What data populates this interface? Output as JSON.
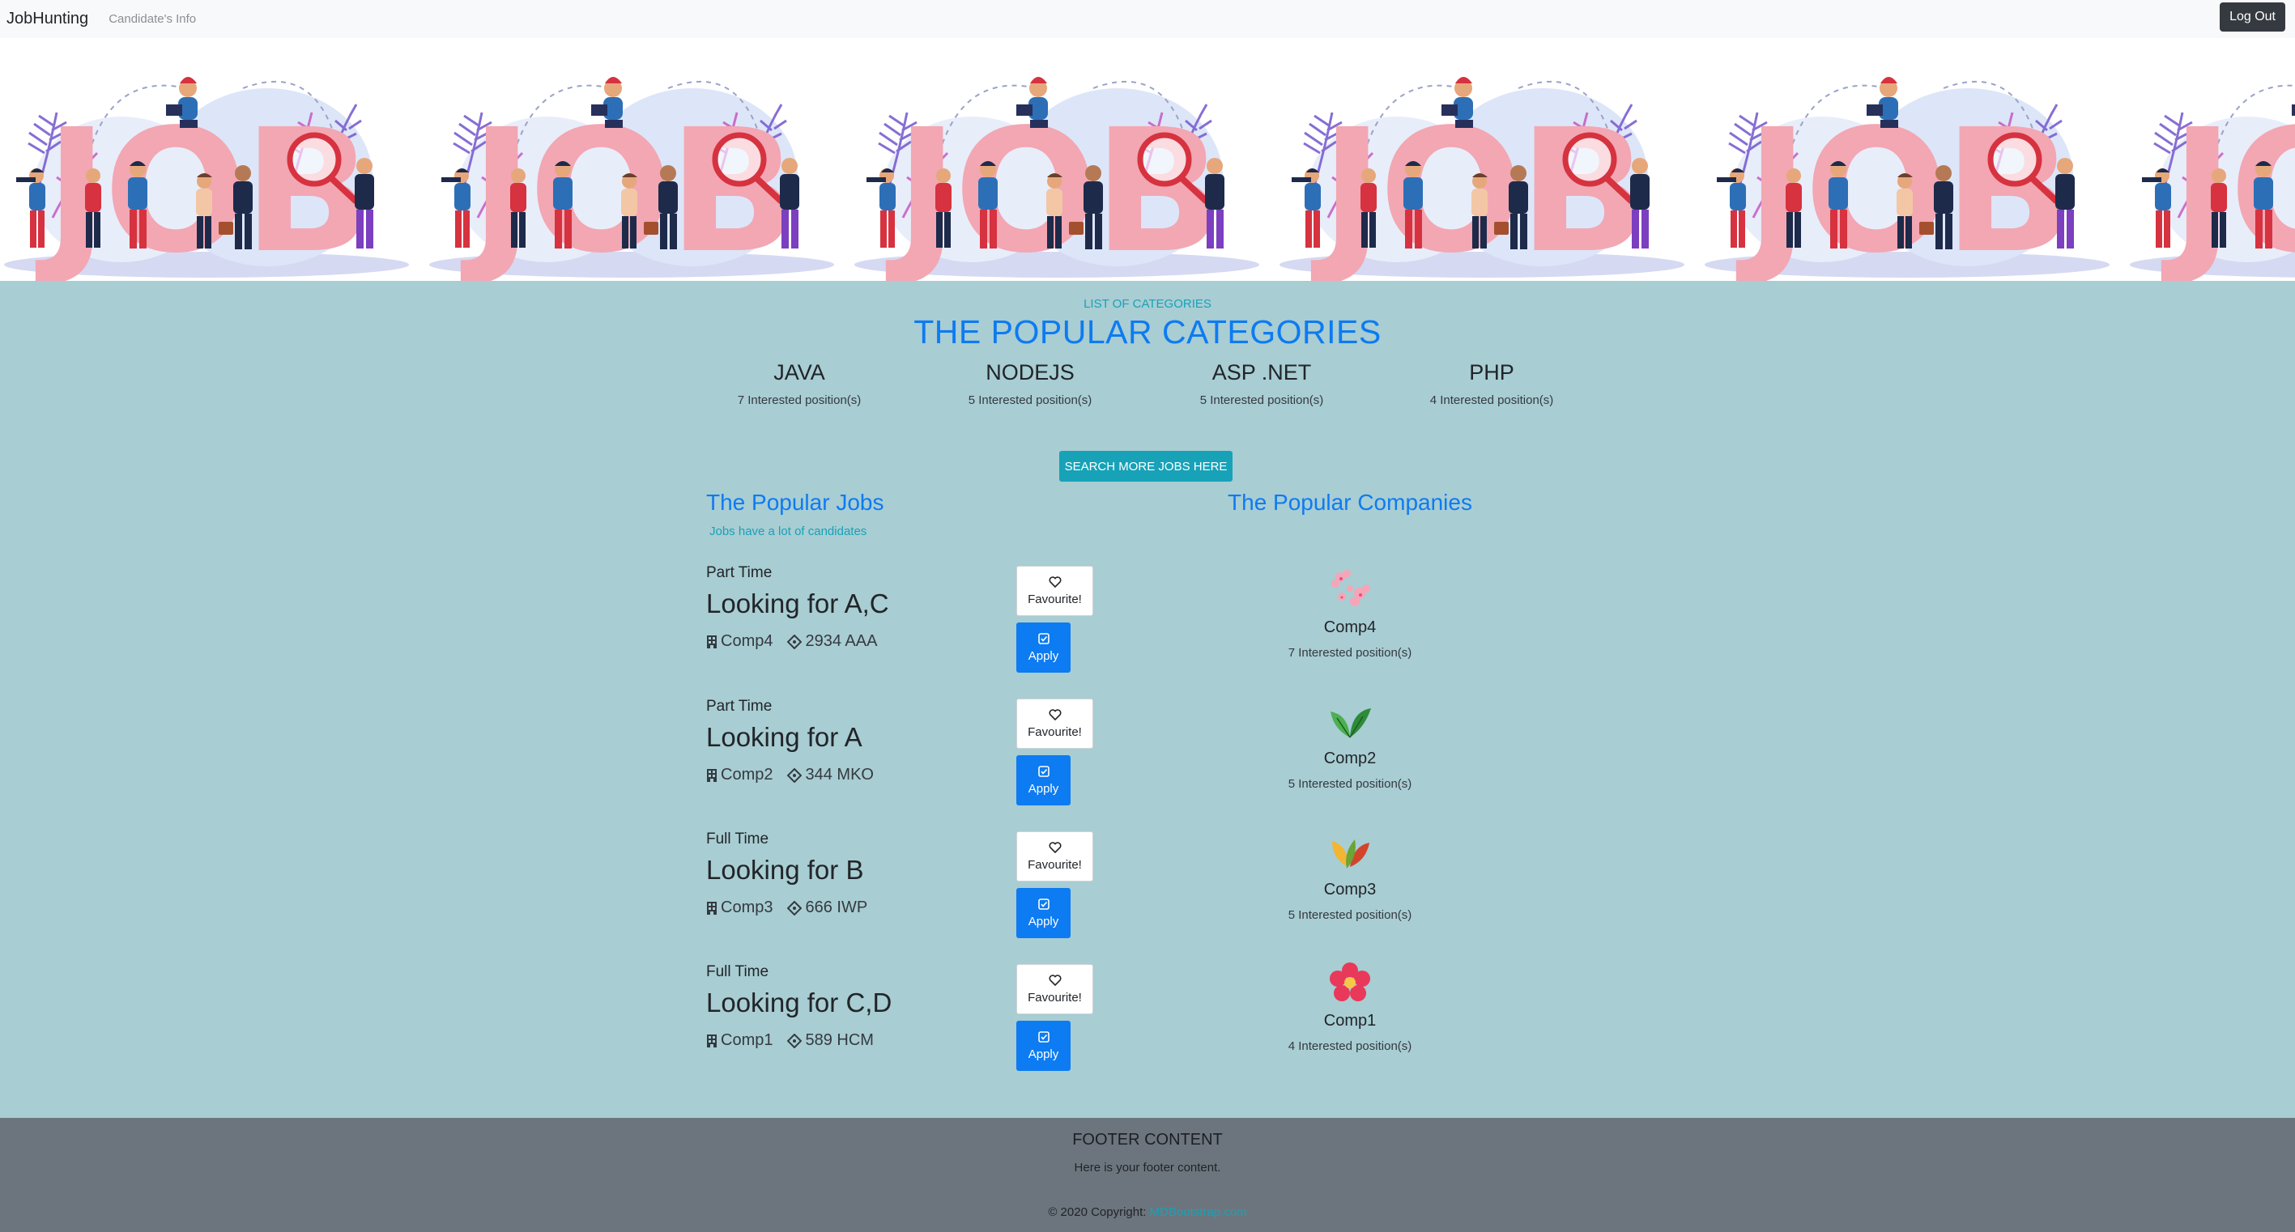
{
  "navbar": {
    "brand": "JobHunting",
    "link": "Candidate's Info",
    "logout": "Log Out"
  },
  "hero": {
    "illustration": "JOB",
    "icon": "job-hunting-illustration"
  },
  "categories": {
    "eyebrow": "LIST OF CATEGORIES",
    "title": "THE POPULAR CATEGORIES",
    "items": [
      {
        "name": "JAVA",
        "count": "7 Interested position(s)"
      },
      {
        "name": "NODEJS",
        "count": "5 Interested position(s)"
      },
      {
        "name": "ASP .NET",
        "count": "5 Interested position(s)"
      },
      {
        "name": "PHP",
        "count": "4 Interested position(s)"
      }
    ],
    "search_button": "SEARCH MORE JOBS HERE"
  },
  "jobs": {
    "title": "The Popular Jobs",
    "subtitle": "Jobs have a lot of candidates",
    "favourite_label": "Favourite!",
    "apply_label": "Apply",
    "items": [
      {
        "type": "Part Time",
        "title": "Looking for A,C",
        "company": "Comp4",
        "address": "2934 AAA"
      },
      {
        "type": "Part Time",
        "title": "Looking for A",
        "company": "Comp2",
        "address": "344 MKO"
      },
      {
        "type": "Full Time",
        "title": "Looking for B",
        "company": "Comp3",
        "address": "666 IWP"
      },
      {
        "type": "Full Time",
        "title": "Looking for C,D",
        "company": "Comp1",
        "address": "589 HCM"
      }
    ]
  },
  "companies": {
    "title": "The Popular Companies",
    "items": [
      {
        "name": "Comp4",
        "count": "7 Interested position(s)",
        "logo": "cherry-blossom-icon"
      },
      {
        "name": "Comp2",
        "count": "5 Interested position(s)",
        "logo": "green-leaves-icon"
      },
      {
        "name": "Comp3",
        "count": "5 Interested position(s)",
        "logo": "autumn-leaves-icon"
      },
      {
        "name": "Comp1",
        "count": "4 Interested position(s)",
        "logo": "red-flower-icon"
      }
    ]
  },
  "footer": {
    "title": "FOOTER CONTENT",
    "text": "Here is your footer content.",
    "copyright": "© 2020 Copyright:",
    "copyright_link": "MDBootstrap.com"
  },
  "colors": {
    "navbar_bg": "#f8f9fa",
    "main_bg": "#a8cdd3",
    "accent_blue": "#0d7bf2",
    "info_teal": "#17a2b8",
    "footer_bg": "#6c757d",
    "dark_button": "#343a40"
  }
}
